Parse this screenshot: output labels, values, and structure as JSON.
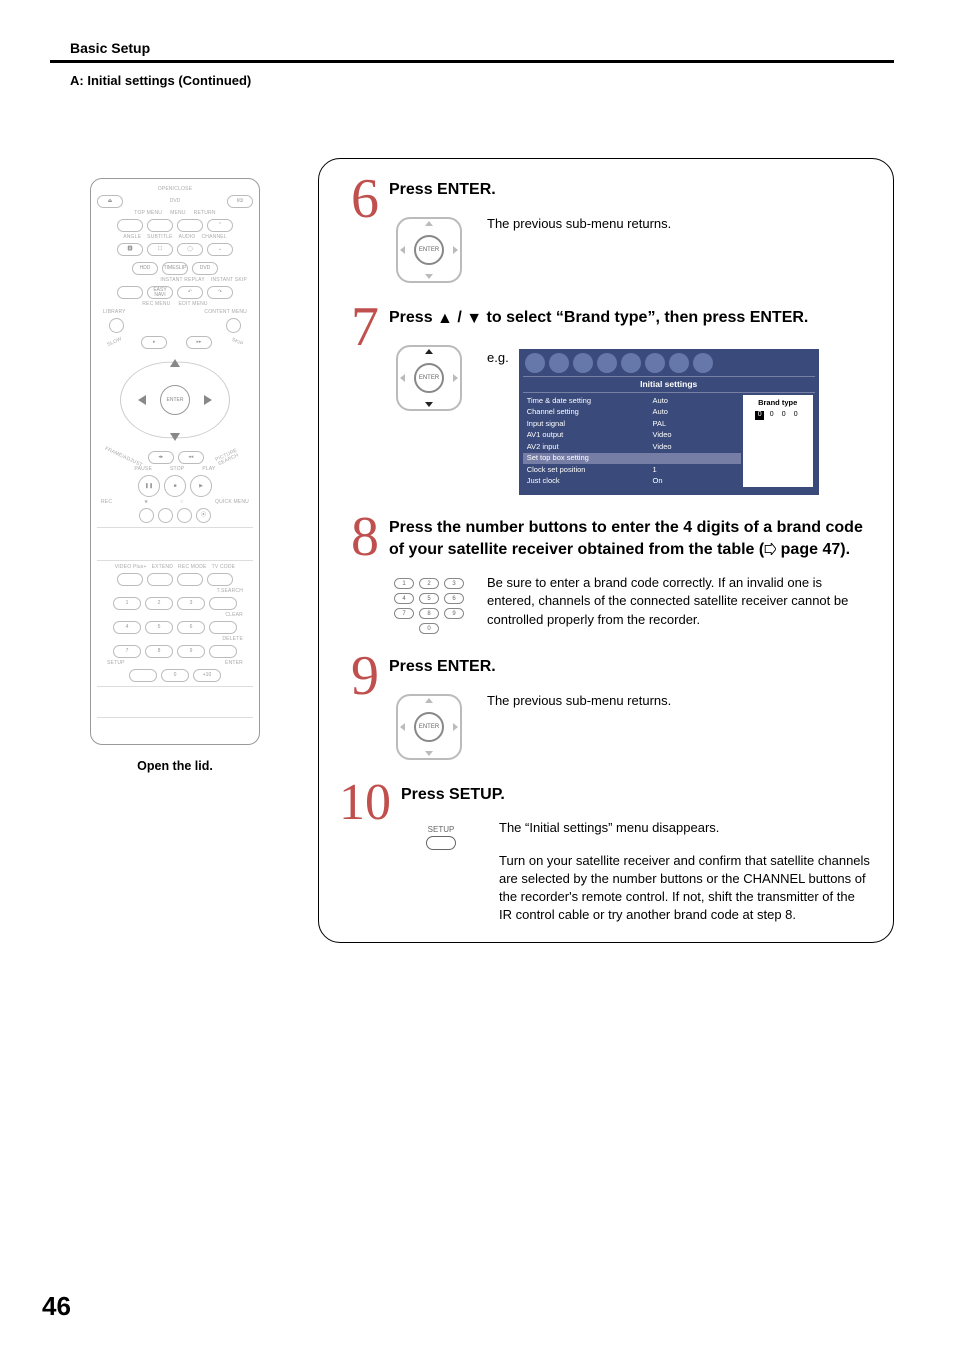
{
  "page": {
    "chapter": "Basic Setup",
    "subtitle": "A: Initial settings (Continued)",
    "number": "46"
  },
  "remote": {
    "caption": "Open the lid.",
    "labels": {
      "open_close": "OPEN/CLOSE",
      "dvd": "DVD",
      "power": "I/⏼",
      "top_menu": "TOP MENU",
      "menu": "MENU",
      "return": "RETURN",
      "angle": "ANGLE",
      "subtitle": "SUBTITLE",
      "audio": "AUDIO",
      "channel": "CHANNEL",
      "hdd": "HDD",
      "timeslip": "TIMESLIP",
      "dvd2": "DVD",
      "instant_replay": "INSTANT REPLAY",
      "instant_skip": "INSTANT SKIP",
      "easy_navi": "EASY\nNAVI",
      "rec_menu": "REC MENU",
      "edit_menu": "EDIT MENU",
      "library": "LIBRARY",
      "content_menu": "CONTENT MENU",
      "slow": "SLOW",
      "skip": "SKIP",
      "enter": "ENTER",
      "frame_adjust": "FRAME/ADJUST",
      "picture_search": "PICTURE SEARCH",
      "pause": "PAUSE",
      "stop": "STOP",
      "play": "PLAY",
      "rec": "REC",
      "quick_menu": "QUICK MENU",
      "videoplus": "VIDEO Plus+",
      "extend": "EXTEND",
      "rec_mode": "REC MODE",
      "tv_code": "TV CODE",
      "tsearch": "T.SEARCH",
      "clear": "CLEAR",
      "delete": "DELETE",
      "setup": "SETUP",
      "enter2": "ENTER",
      "plus10": "+10"
    },
    "numbers": [
      "1",
      "2",
      "3",
      "4",
      "5",
      "6",
      "7",
      "8",
      "9",
      "0"
    ]
  },
  "steps": {
    "s6": {
      "num": "6",
      "title": "Press ENTER.",
      "text": "The previous sub-menu returns.",
      "pad_label": "ENTER"
    },
    "s7": {
      "num": "7",
      "title_before": "Press ",
      "title_mid": " / ",
      "title_after": " to select “Brand type”, then press ENTER.",
      "pad_label": "ENTER",
      "eg_label": "e.g."
    },
    "s8": {
      "num": "8",
      "title_a": "Press the number buttons to enter the 4 digits of a brand code of your satellite receiver obtained from the table (",
      "title_b": " page 47).",
      "text": "Be sure to enter a brand code correctly. If an invalid one is entered, channels of the connected satellite receiver cannot be controlled properly from the recorder.",
      "keys": [
        "1",
        "2",
        "3",
        "4",
        "5",
        "6",
        "7",
        "8",
        "9",
        "0"
      ]
    },
    "s9": {
      "num": "9",
      "title": "Press ENTER.",
      "text": "The previous sub-menu returns.",
      "pad_label": "ENTER"
    },
    "s10": {
      "num": "10",
      "title": "Press SETUP.",
      "setup_label": "SETUP",
      "text1": "The “Initial settings” menu disappears.",
      "text2": "Turn on your satellite receiver and confirm that satellite channels are selected by the number buttons or the CHANNEL buttons of the recorder's remote control. If not, shift the transmitter of the IR control cable or try another brand code at step 8."
    }
  },
  "osd": {
    "title": "Initial settings",
    "rows": [
      {
        "k": "Time & date setting",
        "v": "Auto"
      },
      {
        "k": "Channel setting",
        "v": "Auto"
      },
      {
        "k": "Input signal",
        "v": "PAL"
      },
      {
        "k": "AV1 output",
        "v": "Video"
      },
      {
        "k": "AV2 input",
        "v": "Video"
      }
    ],
    "hl": "Set top box setting",
    "rows2": [
      {
        "k": "Clock set position",
        "v": "1"
      },
      {
        "k": "Just clock",
        "v": "On"
      }
    ],
    "brand_label": "Brand type",
    "brand_digits": [
      "0",
      "0",
      "0",
      "0"
    ]
  }
}
